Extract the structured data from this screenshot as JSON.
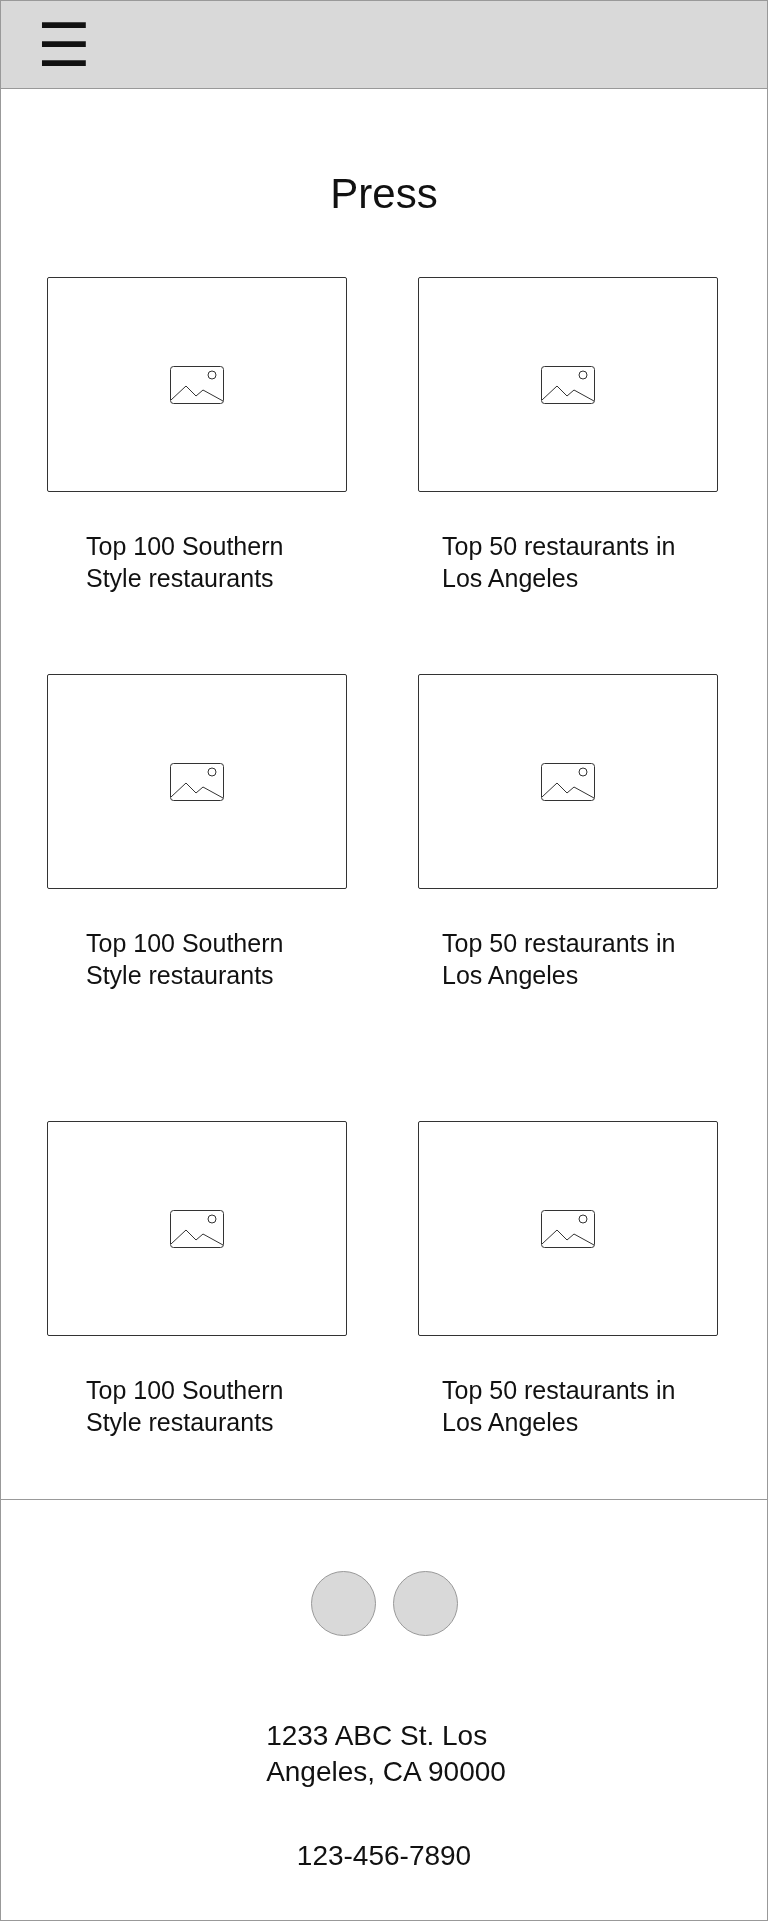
{
  "header": {
    "menu_icon": "☰"
  },
  "title": "Press",
  "articles": [
    {
      "caption_lines": [
        "Top 100 Southern",
        "Style restaurants"
      ]
    },
    {
      "caption_lines": [
        "Top 50 restaurants in",
        "Los Angeles"
      ]
    },
    {
      "caption_lines": [
        "Top 100 Southern",
        "Style restaurants"
      ]
    },
    {
      "caption_lines": [
        "Top 50 restaurants in",
        "Los Angeles"
      ]
    },
    {
      "caption_lines": [
        "Top 100 Southern",
        "Style restaurants"
      ]
    },
    {
      "caption_lines": [
        "Top 50 restaurants in",
        "Los Angeles"
      ]
    }
  ],
  "footer": {
    "address_lines": [
      "1233 ABC St. Los",
      "Angeles, CA 90000"
    ],
    "phone": "123-456-7890"
  }
}
